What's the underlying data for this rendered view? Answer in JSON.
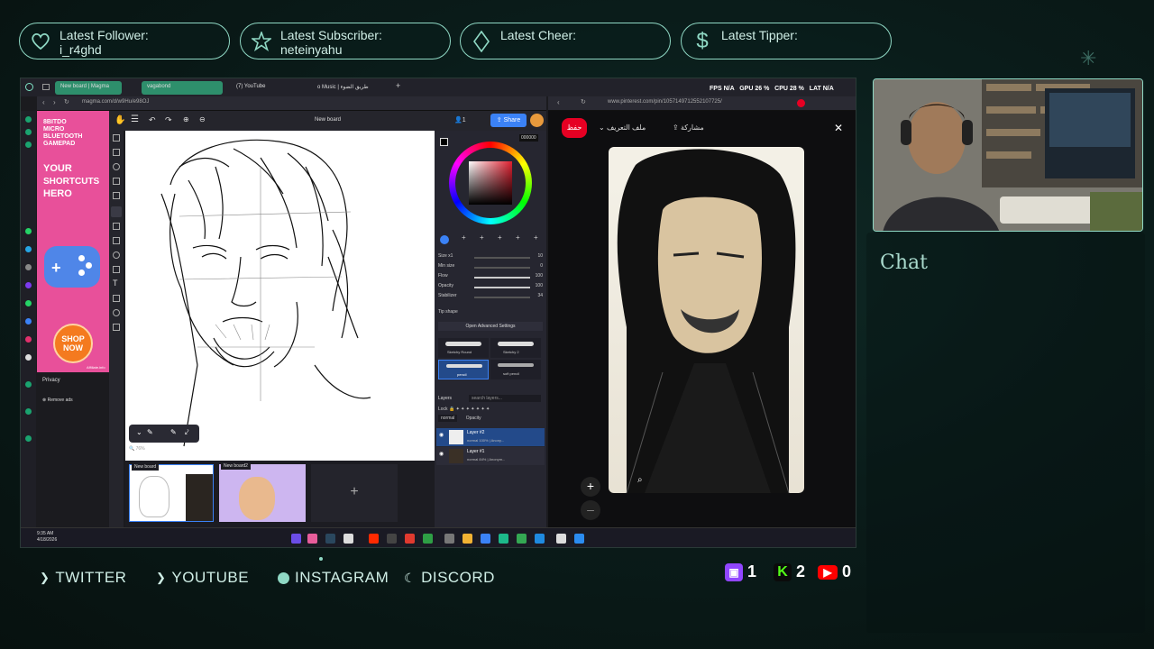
{
  "alerts": [
    {
      "label": "Latest Follower:",
      "value": "i_r4ghd",
      "icon": "heart-icon"
    },
    {
      "label": "Latest Subscriber:",
      "value": "neteinyahu",
      "icon": "star-icon"
    },
    {
      "label": "Latest Cheer:",
      "value": "",
      "icon": "diamond-icon"
    },
    {
      "label": "Latest Tipper:",
      "value": "",
      "icon": "dollar-icon"
    }
  ],
  "browser": {
    "tabs": [
      "New board | Magma",
      "vagabond",
      "(7) YouTube",
      "o Music | طريق الضوء"
    ],
    "left_url": "magma.com/d/w9Hu/e98OJ",
    "right_url": "www.pinterest.com/pin/1057149712552107725/"
  },
  "stats": {
    "fps_label": "FPS",
    "fps": "N/A",
    "gpu_label": "GPU",
    "gpu": "26 %",
    "cpu_label": "CPU",
    "cpu": "28 %",
    "lat_label": "LAT",
    "lat": "N/A"
  },
  "ad": {
    "line1": "8BITDO",
    "line2": "MICRO",
    "line3": "BLUETOOTH",
    "line4": "GAMEPAD",
    "tag1": "YOUR",
    "tag2": "SHORTCUTS",
    "tag3": "HERO",
    "cta1": "SHOP",
    "cta2": "NOW",
    "privacy": "Privacy",
    "remove": "Remove ads",
    "affiliate": "Affiliate.info"
  },
  "magma": {
    "board_title": "New board",
    "share": "Share",
    "user_count": "1",
    "zoom": "76%",
    "hex": "000000",
    "brush": {
      "rows": [
        {
          "label": "Size x1",
          "value": "10"
        },
        {
          "label": "Min size",
          "value": "0"
        },
        {
          "label": "Flow",
          "value": "100"
        },
        {
          "label": "Opacity",
          "value": "100"
        },
        {
          "label": "Stabilizer",
          "value": "34"
        }
      ],
      "tip_shape": "Tip shape",
      "advanced": "Open Advanced Settings",
      "presets": [
        "Sketchy Round",
        "Sketchy 2",
        "pencil",
        "soft pencil"
      ]
    },
    "layers_title": "Layers",
    "layers_search": "search layers...",
    "lock_label": "Lock",
    "blend": "normal",
    "opacity_label": "Opacity",
    "layers": [
      {
        "name": "Layer #2",
        "meta": "normal 100% | Anony..."
      },
      {
        "name": "Layer #1",
        "meta": "normal 84% | Anonym..."
      }
    ],
    "boards": [
      "New board",
      "New board2"
    ],
    "add_board": "+"
  },
  "pinterest": {
    "save": "حفظ",
    "profile": "ملف التعريف",
    "share": "مشاركة",
    "close": "✕",
    "zoom_in": "+",
    "zoom_out": "–"
  },
  "taskbar": {
    "time": "9:35 AM",
    "date": "4/18/2026"
  },
  "chat": {
    "title": "Chat"
  },
  "socials": [
    {
      "label": "TWITTER",
      "icon": "chevron-right-icon"
    },
    {
      "label": "YOUTUBE",
      "icon": "chevron-right-icon"
    },
    {
      "label": "INSTAGRAM",
      "icon": "dot-icon"
    },
    {
      "label": "DISCORD",
      "icon": "moon-icon"
    }
  ],
  "counters": [
    {
      "platform": "twitch",
      "value": "1",
      "color": "#9146ff"
    },
    {
      "platform": "kick",
      "value": "2",
      "color": "#53fc18"
    },
    {
      "platform": "youtube",
      "value": "0",
      "color": "#ff0000"
    }
  ],
  "colors": {
    "accent": "#8fd8c4",
    "bg": "#0a1c1a",
    "ad_pink": "#e8509a",
    "magma_blue": "#3b82f6",
    "pin_red": "#e60023"
  }
}
